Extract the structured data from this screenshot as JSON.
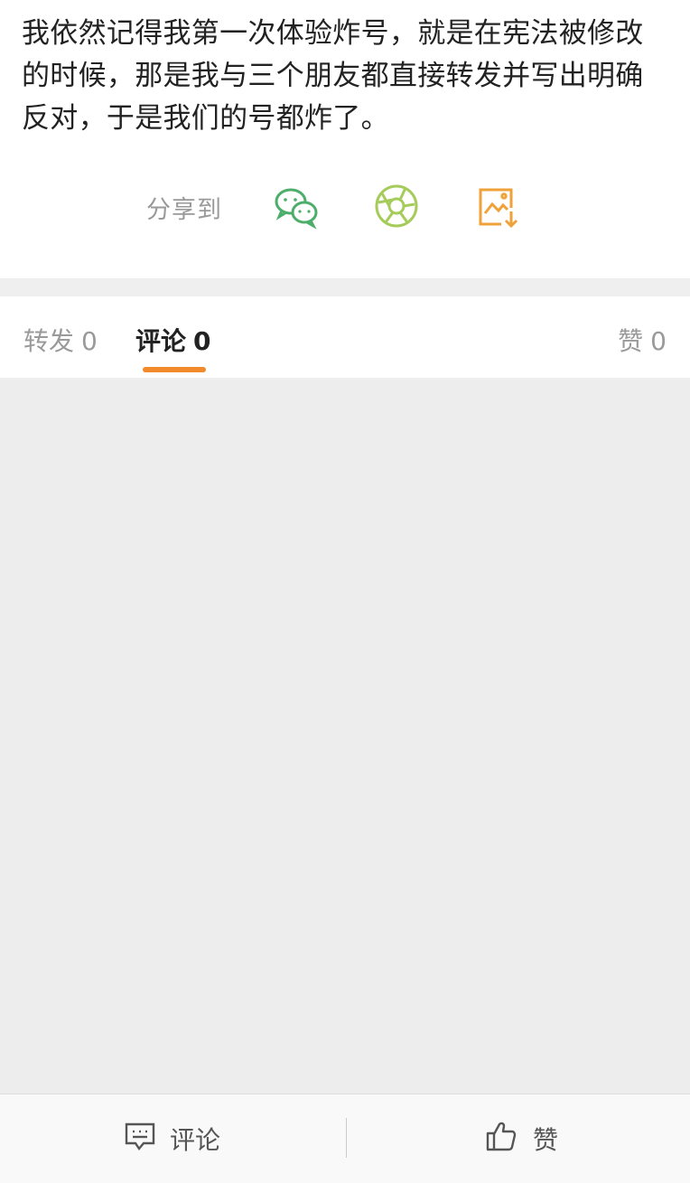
{
  "post": {
    "text": "我依然记得我第一次体验炸号，就是在宪法被修改的时候，那是我与三个朋友都直接转发并写出明确反对，于是我们的号都炸了。"
  },
  "share": {
    "label": "分享到",
    "targets": [
      {
        "icon": "wechat-icon",
        "color": "#4cae6a"
      },
      {
        "icon": "moments-icon",
        "color": "#a5cc5a"
      },
      {
        "icon": "save-image-icon",
        "color": "#f0a23a"
      }
    ]
  },
  "tabs": [
    {
      "label": "转发",
      "count": "0",
      "active": false
    },
    {
      "label": "评论",
      "count": "0",
      "active": true
    },
    {
      "label": "赞",
      "count": "0",
      "active": false
    }
  ],
  "colors": {
    "accent": "#f08a2a",
    "background": "#ededed"
  },
  "bottom_bar": {
    "comment_label": "评论",
    "like_label": "赞"
  }
}
